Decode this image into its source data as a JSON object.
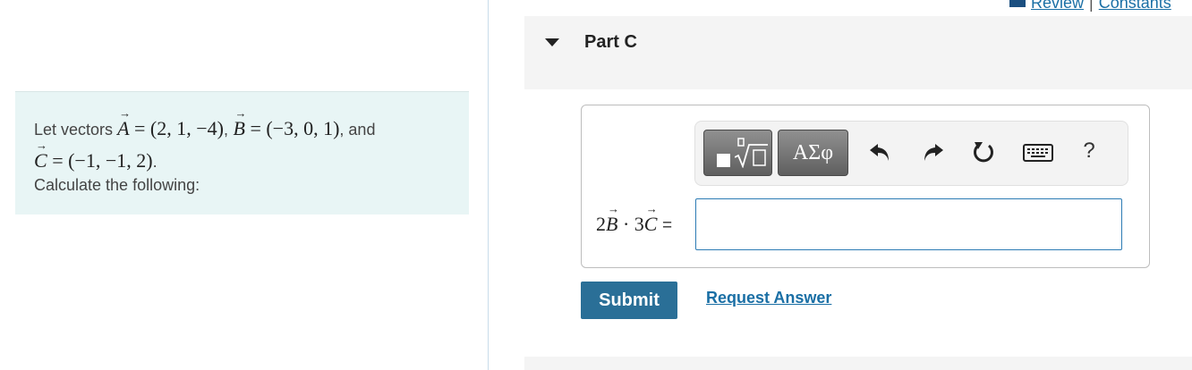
{
  "top_links": {
    "review": "Review",
    "separator": "|",
    "constants": "Constants"
  },
  "problem": {
    "intro": "Let vectors",
    "A_value": "= (2, 1, −4)",
    "B_value": "= (−3, 0, 1)",
    "and_text": ", and",
    "C_value": "= (−1, −1, 2)",
    "calc_text": "Calculate the following:",
    "vec_A": "A",
    "vec_B": "B",
    "vec_C": "C"
  },
  "part": {
    "title": "Part C"
  },
  "toolbar": {
    "greek_label": "ΑΣφ",
    "help_label": "?",
    "icons": [
      "templates-icon",
      "greek-letters-icon",
      "undo-icon",
      "redo-icon",
      "reset-icon",
      "keyboard-icon",
      "help-icon"
    ]
  },
  "equation": {
    "coef_B": "2",
    "dot": "·",
    "coef_C": "3",
    "equals": "="
  },
  "answer_input": {
    "value": ""
  },
  "actions": {
    "submit_label": "Submit",
    "request_answer_label": "Request Answer"
  },
  "colors": {
    "accent": "#2a6f97",
    "link": "#1a6fa5",
    "problem_bg": "#e8f5f5",
    "input_border": "#2c7bb4"
  }
}
